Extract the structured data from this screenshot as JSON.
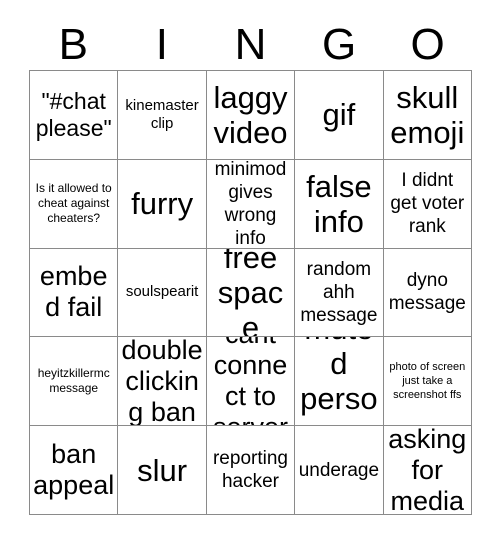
{
  "card": {
    "title": "BINGO",
    "header_letters": [
      "B",
      "I",
      "N",
      "G",
      "O"
    ],
    "grid_size": "5x5",
    "colors": {
      "background": "#ffffff",
      "text": "#000000",
      "grid_line": "#8a8a8a"
    },
    "cells": [
      {
        "text": "\"#chat please\"",
        "size": "lg"
      },
      {
        "text": "kinemaster clip",
        "size": "sm"
      },
      {
        "text": "laggy video",
        "size": "xxl"
      },
      {
        "text": "gif",
        "size": "xxl"
      },
      {
        "text": "skull emoji",
        "size": "xxl"
      },
      {
        "text": "Is it allowed to cheat against cheaters?",
        "size": "xs"
      },
      {
        "text": "furry",
        "size": "xxl"
      },
      {
        "text": "minimod gives wrong info",
        "size": "md"
      },
      {
        "text": "false info",
        "size": "xxl"
      },
      {
        "text": "I didnt get voter rank",
        "size": "md"
      },
      {
        "text": "embed fail",
        "size": "xl"
      },
      {
        "text": "soulspearit",
        "size": "sm"
      },
      {
        "text": "free space",
        "size": "xxl"
      },
      {
        "text": "random ahh message",
        "size": "md"
      },
      {
        "text": "dyno message",
        "size": "md"
      },
      {
        "text": "heyitzkillermc message",
        "size": "xs"
      },
      {
        "text": "double clicking ban",
        "size": "xl"
      },
      {
        "text": "cant connect to server",
        "size": "xl"
      },
      {
        "text": "muted person",
        "size": "xxl"
      },
      {
        "text": "photo of screen just take a screenshot ffs",
        "size": "xxs"
      },
      {
        "text": "ban appeal",
        "size": "xl"
      },
      {
        "text": "slur",
        "size": "xxl"
      },
      {
        "text": "reporting hacker",
        "size": "md"
      },
      {
        "text": "underage",
        "size": "md"
      },
      {
        "text": "asking for media",
        "size": "xl"
      }
    ]
  }
}
